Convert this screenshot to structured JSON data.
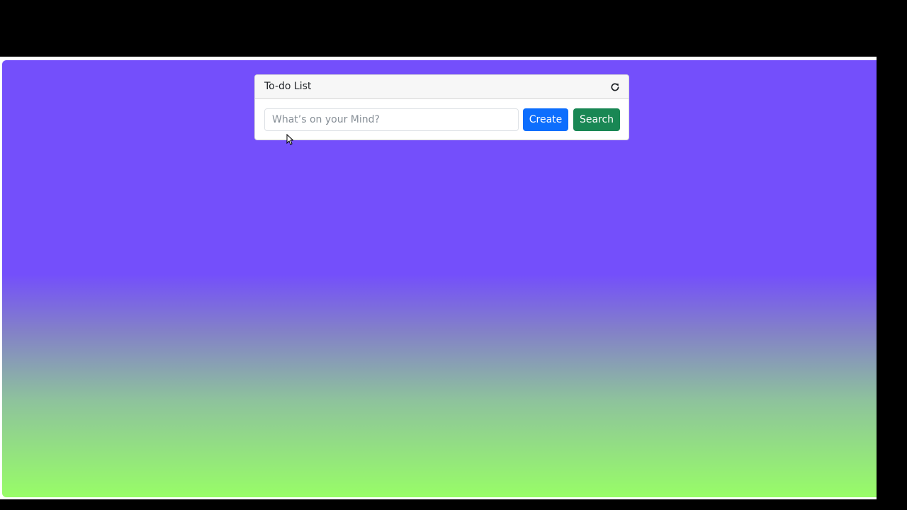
{
  "card": {
    "title": "To-do List",
    "refresh_icon": "refresh-icon"
  },
  "input": {
    "placeholder": "What’s on your Mind?",
    "value": ""
  },
  "buttons": {
    "create_label": "Create",
    "search_label": "Search"
  },
  "colors": {
    "gradient_top": "#744ffb",
    "gradient_bottom": "#98fd67",
    "create_button": "#0d6efd",
    "search_button": "#198754"
  }
}
